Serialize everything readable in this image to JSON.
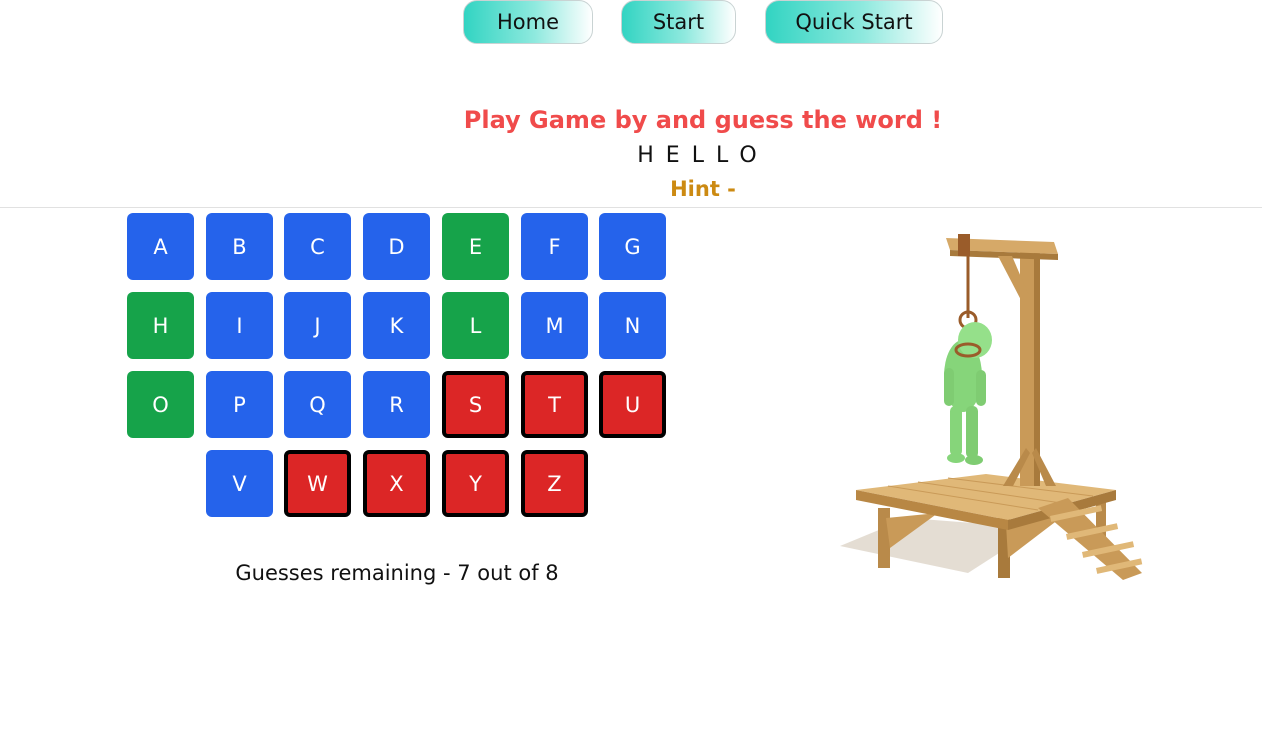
{
  "nav": {
    "home_label": "Home",
    "start_label": "Start",
    "quick_start_label": "Quick Start"
  },
  "game": {
    "title": "Play Game by and guess the word !",
    "word": "HELLO",
    "hint": "Hint -",
    "guesses_text": "Guesses remaining - 7 out of 8",
    "guesses_remaining": 7,
    "guesses_total": 8
  },
  "keyboard": {
    "keys": [
      {
        "letter": "A",
        "state": "unused"
      },
      {
        "letter": "B",
        "state": "unused"
      },
      {
        "letter": "C",
        "state": "unused"
      },
      {
        "letter": "D",
        "state": "unused"
      },
      {
        "letter": "E",
        "state": "correct"
      },
      {
        "letter": "F",
        "state": "unused"
      },
      {
        "letter": "G",
        "state": "unused"
      },
      {
        "letter": "H",
        "state": "correct"
      },
      {
        "letter": "I",
        "state": "unused"
      },
      {
        "letter": "J",
        "state": "unused"
      },
      {
        "letter": "K",
        "state": "unused"
      },
      {
        "letter": "L",
        "state": "correct"
      },
      {
        "letter": "M",
        "state": "unused"
      },
      {
        "letter": "N",
        "state": "unused"
      },
      {
        "letter": "O",
        "state": "correct"
      },
      {
        "letter": "P",
        "state": "unused"
      },
      {
        "letter": "Q",
        "state": "unused"
      },
      {
        "letter": "R",
        "state": "unused"
      },
      {
        "letter": "S",
        "state": "wrong"
      },
      {
        "letter": "T",
        "state": "wrong"
      },
      {
        "letter": "U",
        "state": "wrong"
      },
      {
        "letter": "V",
        "state": "unused"
      },
      {
        "letter": "W",
        "state": "wrong"
      },
      {
        "letter": "X",
        "state": "wrong"
      },
      {
        "letter": "Y",
        "state": "wrong"
      },
      {
        "letter": "Z",
        "state": "wrong"
      }
    ]
  },
  "colors": {
    "unused": "#2563eb",
    "correct": "#16a34a",
    "wrong": "#dc2626",
    "title": "#f04b4b",
    "hint": "#cc8a12"
  },
  "image": {
    "icon": "hangman-gallows-icon"
  }
}
